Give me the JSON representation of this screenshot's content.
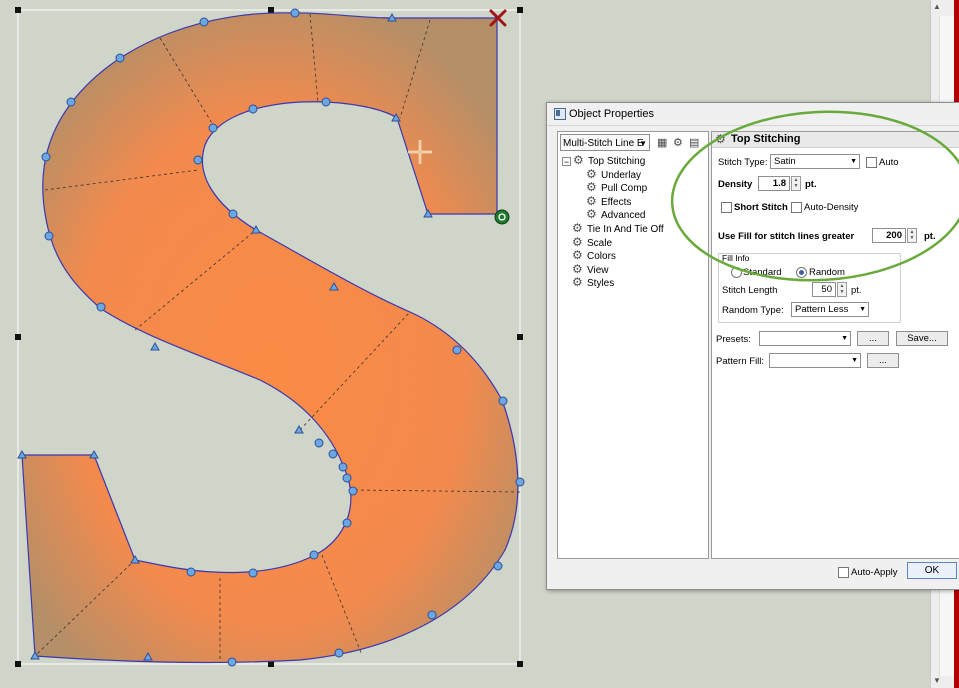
{
  "dialog": {
    "title": "Object Properties",
    "object_combo": "Multi-Stitch Line E",
    "tree": [
      {
        "label": "Top Stitching",
        "level": "root"
      },
      {
        "label": "Underlay",
        "level": "child"
      },
      {
        "label": "Pull Comp",
        "level": "child"
      },
      {
        "label": "Effects",
        "level": "child"
      },
      {
        "label": "Advanced",
        "level": "child"
      },
      {
        "label": "Tie In And Tie Off",
        "level": "top"
      },
      {
        "label": "Scale",
        "level": "top"
      },
      {
        "label": "Colors",
        "level": "top"
      },
      {
        "label": "View",
        "level": "top"
      },
      {
        "label": "Styles",
        "level": "top"
      }
    ],
    "section_title": "Top Stitching",
    "stitch_type_label": "Stitch Type:",
    "stitch_type_value": "Satin",
    "auto_label": "Auto",
    "density_label": "Density",
    "density_value": "1.8",
    "density_unit": "pt.",
    "short_stitch_label": "Short Stitch",
    "auto_density_label": "Auto-Density",
    "use_fill_label": "Use Fill for stitch lines greater",
    "use_fill_value": "200",
    "use_fill_unit": "pt.",
    "fill_info_label": "Fill Info",
    "standard_label": "Standard",
    "random_label": "Random",
    "stitch_length_label": "Stitch Length",
    "stitch_length_value": "50",
    "stitch_length_unit": "pt.",
    "random_type_label": "Random Type:",
    "random_type_value": "Pattern Less",
    "presets_label": "Presets:",
    "presets_value": "",
    "ellipsis_label": "...",
    "save_label": "Save...",
    "pattern_fill_label": "Pattern Fill:",
    "pattern_fill_value": "",
    "auto_apply_label": "Auto-Apply",
    "ok_label": "OK"
  },
  "colors": {
    "canvas_bg": "#cfd5c9",
    "fill_orange": "#fb8a46",
    "stitch_shade": "#8a9a78",
    "outline": "#3a36b0",
    "node": "#6aa7e3",
    "highlight_circle": "#6aa93c",
    "end_marker": "#a01515",
    "start_marker": "#1f7a2e"
  }
}
